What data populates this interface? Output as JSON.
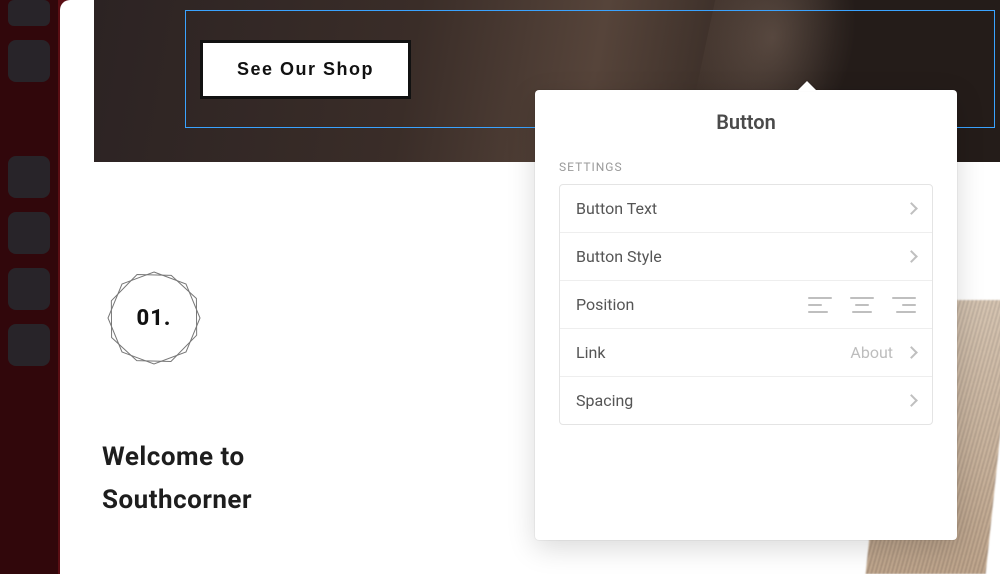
{
  "hero": {
    "button_label": "See Our Shop"
  },
  "section": {
    "badge_number": "01.",
    "welcome_line1": "Welcome to",
    "welcome_line2": "Southcorner"
  },
  "popover": {
    "title": "Button",
    "section_label": "SETTINGS",
    "rows": {
      "button_text": "Button Text",
      "button_style": "Button Style",
      "position": "Position",
      "link": "Link",
      "link_value": "About",
      "spacing": "Spacing"
    }
  }
}
